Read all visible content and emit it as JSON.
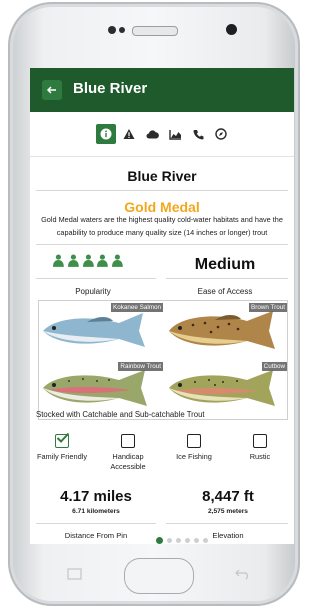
{
  "app": {
    "title": "Blue River",
    "back_icon": "arrow-left-icon"
  },
  "tabs": [
    {
      "icon": "info-icon",
      "active": true
    },
    {
      "icon": "warning-icon",
      "active": false
    },
    {
      "icon": "cloud-icon",
      "active": false
    },
    {
      "icon": "chart-icon",
      "active": false
    },
    {
      "icon": "phone-icon",
      "active": false
    },
    {
      "icon": "compass-icon",
      "active": false
    }
  ],
  "water": {
    "name": "Blue River",
    "designation": "Gold Medal",
    "description": "Gold Medal waters are the highest quality cold-water habitats and have the capability to produce many quality size (14 inches or longer) trout"
  },
  "popularity": {
    "label": "Popularity",
    "rating": 5,
    "max": 5,
    "icon": "fish-icon"
  },
  "access": {
    "value": "Medium",
    "label": "Ease of Access"
  },
  "fish": [
    {
      "name": "Kokanee Salmon"
    },
    {
      "name": "Brown Trout"
    },
    {
      "name": "Rainbow Trout"
    },
    {
      "name": "Cutbow"
    }
  ],
  "stocking": "Stocked with Catchable and Sub-catchable Trout",
  "amenities": [
    {
      "label": "Family Friendly",
      "checked": true
    },
    {
      "label": "Handicap Accessible",
      "checked": false
    },
    {
      "label": "Ice Fishing",
      "checked": false
    },
    {
      "label": "Rustic",
      "checked": false
    }
  ],
  "distance": {
    "value": "4.17 miles",
    "sub": "6.71 kilometers",
    "label": "Distance From Pin"
  },
  "elevation": {
    "value": "8,447 ft",
    "sub": "2,575 meters",
    "label": "Elevation"
  },
  "pager": {
    "pages": 6,
    "current": 1
  },
  "colors": {
    "primary": "#1e5a2c",
    "accent": "#2f7a3e",
    "gold": "#f2a81d"
  }
}
